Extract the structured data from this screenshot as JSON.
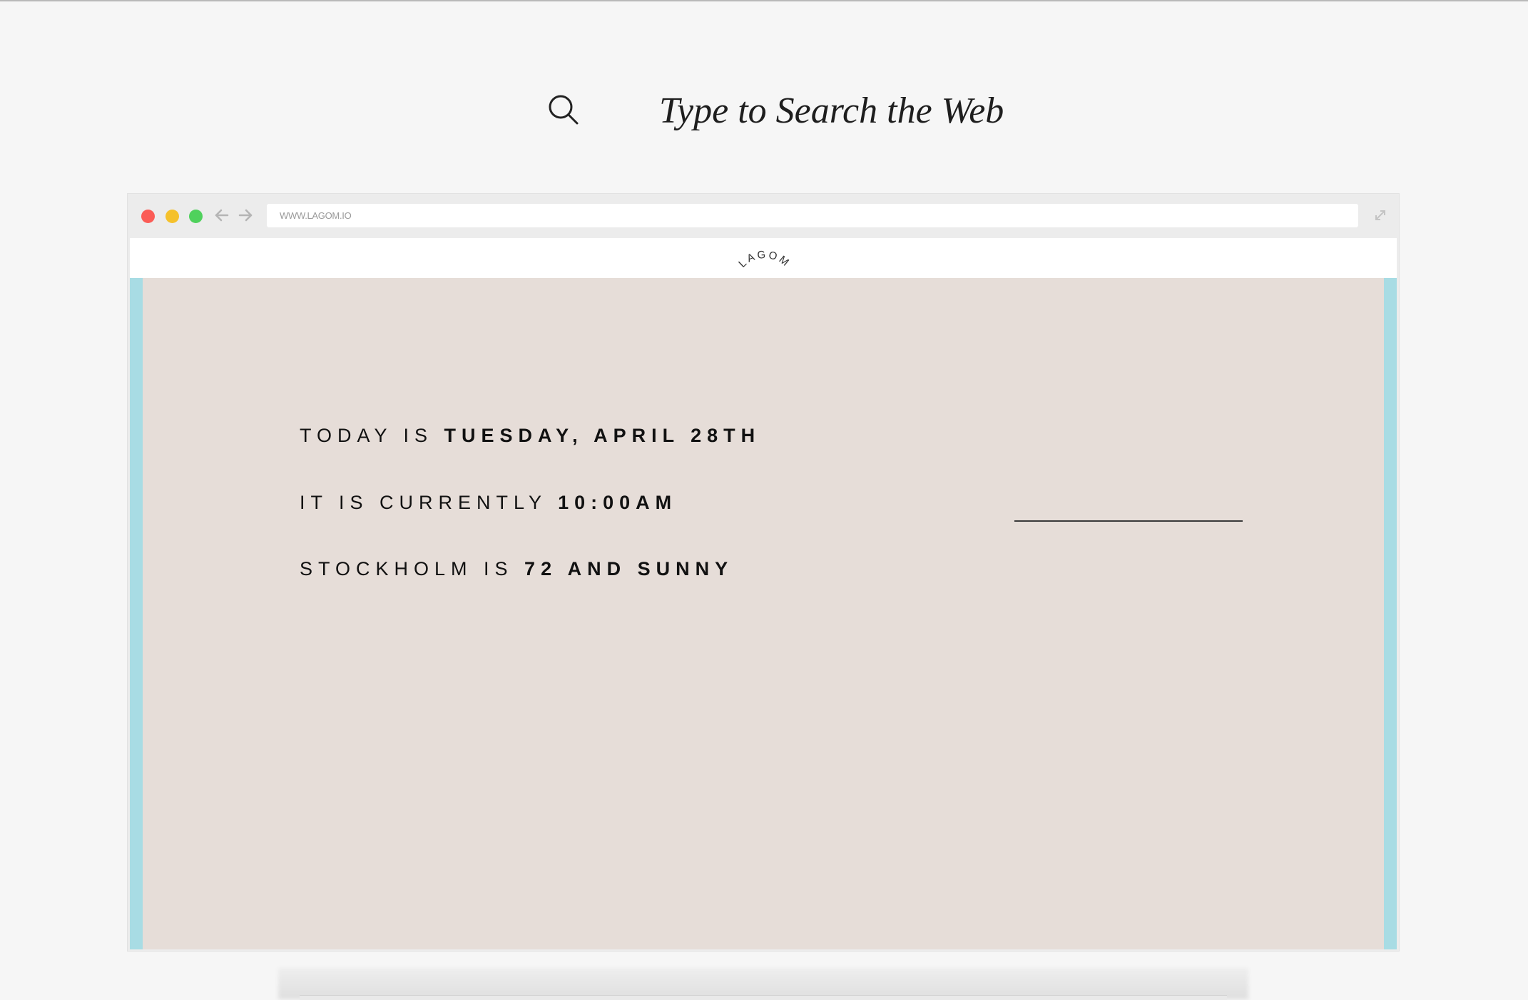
{
  "search": {
    "placeholder": "Type to Search the Web",
    "icon": "search-icon"
  },
  "browser": {
    "url": "WWW.LAGOM.IO",
    "traffic_lights": [
      "#fb5c56",
      "#f5c12b",
      "#4fd15c"
    ],
    "back_icon": "arrow-left-icon",
    "forward_icon": "arrow-right-icon",
    "expand_icon": "expand-icon"
  },
  "site": {
    "logo": "LAGOM",
    "lines": [
      {
        "label": "TODAY IS",
        "value": "TUESDAY, APRIL 28TH"
      },
      {
        "label": "IT IS CURRENTLY",
        "value": "10:00AM"
      },
      {
        "label": "STOCKHOLM IS",
        "value": "72 AND SUNNY"
      }
    ]
  },
  "colors": {
    "page_background": "#f6f6f6",
    "content_background": "#e6ddd8",
    "side_accent": "#a8dce4"
  }
}
